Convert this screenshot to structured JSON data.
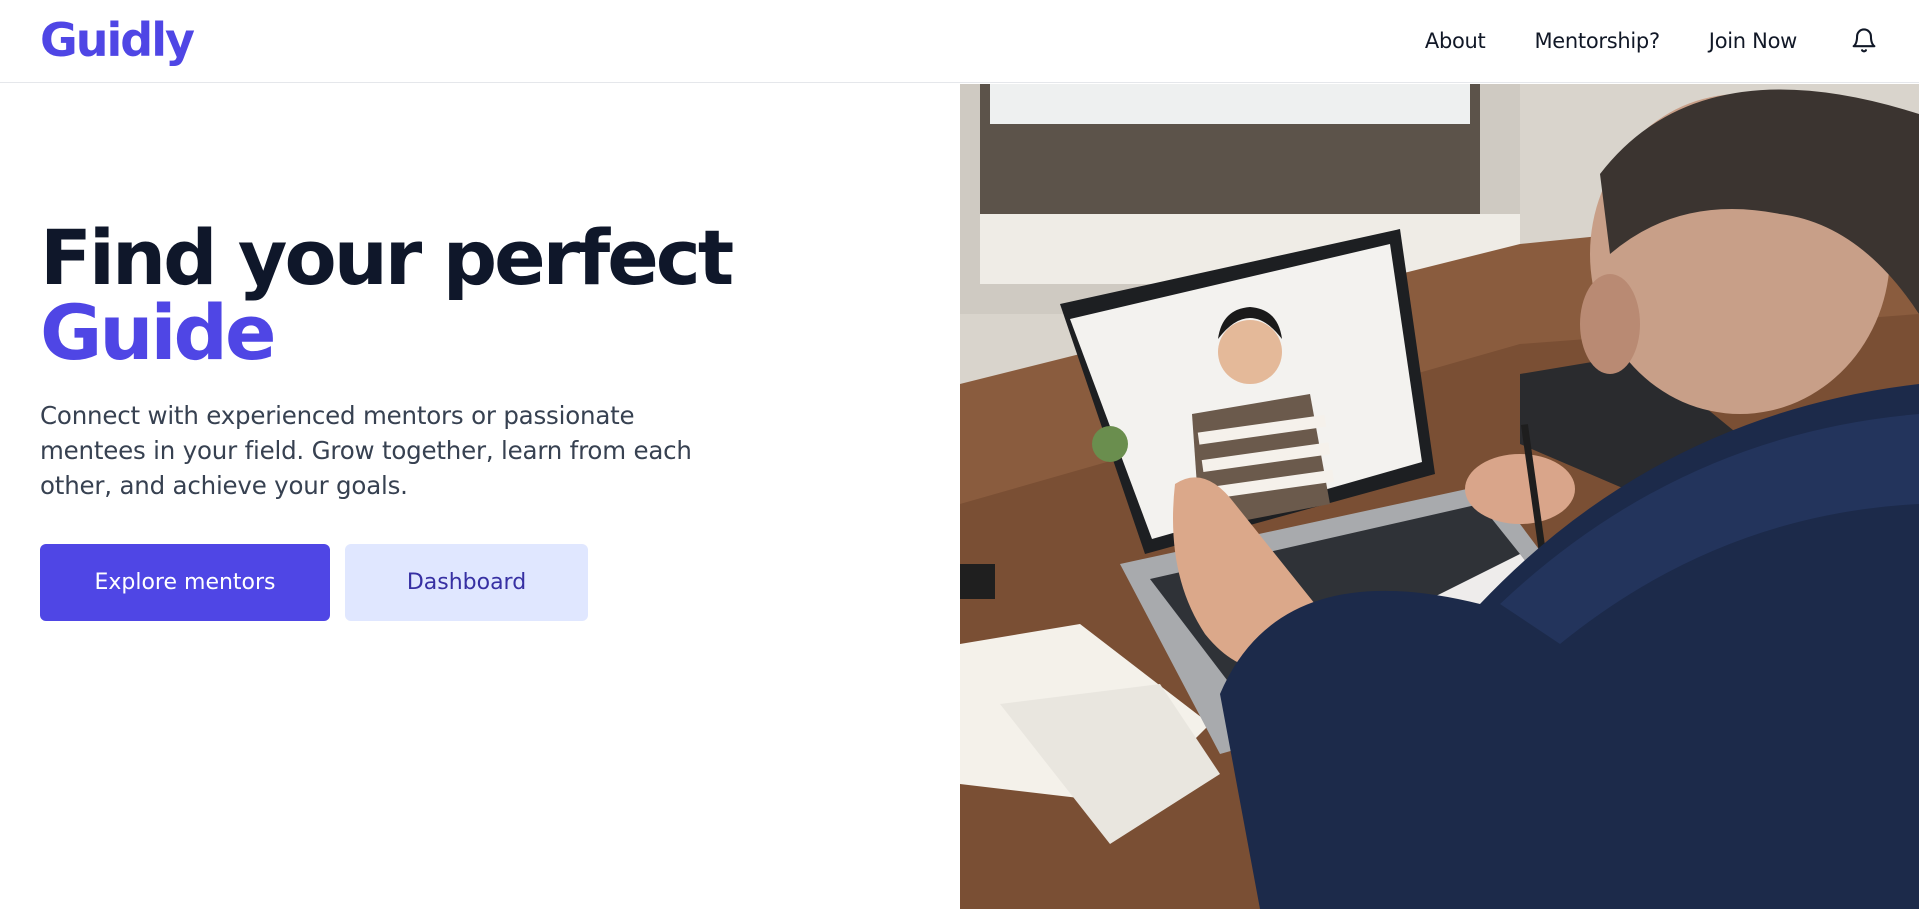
{
  "brand": {
    "name": "Guidly",
    "color": "#4f46e5"
  },
  "nav": {
    "links": [
      {
        "label": "About"
      },
      {
        "label": "Mentorship?"
      },
      {
        "label": "Join Now"
      }
    ],
    "notification_icon": "bell-icon"
  },
  "hero": {
    "headline_line1": "Find your perfect",
    "headline_accent": "Guide",
    "subtext": "Connect with experienced mentors or passionate mentees in your field. Grow together, learn from each other, and achieve your goals.",
    "primary_button": "Explore mentors",
    "secondary_button": "Dashboard",
    "image": "photo: man at desk on a video call with a smiling young man on a laptop, holding a pen and worksheet"
  },
  "colors": {
    "accent": "#4f46e5",
    "secondary_button_bg": "#e0e7ff",
    "heading": "#0f172a"
  }
}
